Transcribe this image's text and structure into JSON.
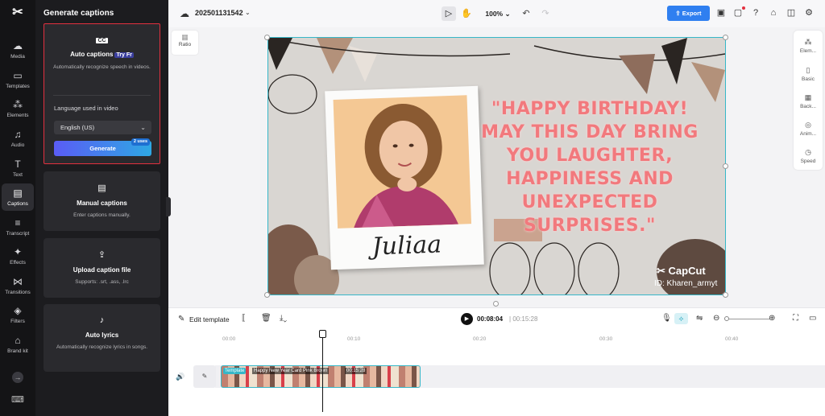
{
  "leftnav": {
    "logo_icon": "capcut-logo-icon",
    "items": [
      {
        "label": "Media",
        "icon": "☁"
      },
      {
        "label": "Templates",
        "icon": "▭"
      },
      {
        "label": "Elements",
        "icon": "⁂"
      },
      {
        "label": "Audio",
        "icon": "♫"
      },
      {
        "label": "Text",
        "icon": "T"
      },
      {
        "label": "Captions",
        "icon": "▤"
      },
      {
        "label": "Transcript",
        "icon": "≡"
      },
      {
        "label": "Effects",
        "icon": "✦"
      },
      {
        "label": "Transitions",
        "icon": "⋈"
      },
      {
        "label": "Filters",
        "icon": "◈"
      },
      {
        "label": "Brand kit",
        "icon": "⌂"
      }
    ],
    "more_icon": "→",
    "keyboard_icon": "⌨"
  },
  "panel": {
    "title": "Generate captions",
    "auto": {
      "icon": "CC",
      "title": "Auto captions",
      "try_free": "Try Fr",
      "desc": "Automatically recognize speech in videos.",
      "lang_label": "Language used in video",
      "lang_value": "English (US)",
      "generate": "Generate",
      "uses": "2 uses"
    },
    "manual": {
      "icon": "▤",
      "title": "Manual captions",
      "desc": "Enter captions manually."
    },
    "upload": {
      "icon": "⇪",
      "title": "Upload caption file",
      "desc": "Supports: .srt, .ass, .lrc"
    },
    "lyrics": {
      "icon": "♪",
      "title": "Auto lyrics",
      "desc": "Automatically recognize lyrics in songs."
    }
  },
  "topbar": {
    "project_name": "202501131542",
    "zoom": "100%",
    "export": "Export"
  },
  "canvas": {
    "ratio_label": "Ratio",
    "quote": "\"HAPPY BIRTHDAY! MAY THIS DAY BRING YOU LAUGHTER, HAPPINESS AND UNEXPECTED SURPRISES.\"",
    "name": "Juliaa",
    "brand": "CapCut",
    "user_id": "ID: Kharen_armyt"
  },
  "right_tools": [
    {
      "label": "Elem...",
      "icon": "⁂"
    },
    {
      "label": "Basic",
      "icon": "▯"
    },
    {
      "label": "Back...",
      "icon": "▦"
    },
    {
      "label": "Anim...",
      "icon": "◎"
    },
    {
      "label": "Speed",
      "icon": "◷"
    }
  ],
  "timeline": {
    "edit_template": "Edit template",
    "current_time": "00:08:04",
    "total_time": "00:15:28",
    "ruler": [
      "00:00",
      "00:10",
      "00:20",
      "00:30",
      "00:40"
    ],
    "clip_tag": "Template",
    "clip_name": "Happy New Year Card Pink Brown",
    "clip_duration": "00:15:28"
  },
  "colors": {
    "accent": "#2f7ff0",
    "selection": "#36b7c8",
    "highlight_border": "#e3303f",
    "quote": "#f2797d"
  }
}
